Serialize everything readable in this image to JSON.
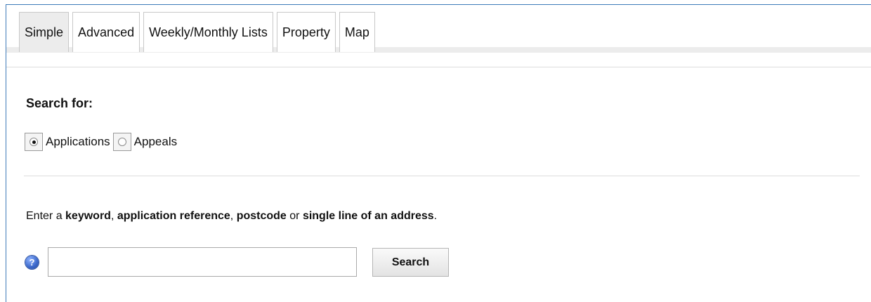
{
  "tabs": [
    {
      "label": "Simple",
      "active": true
    },
    {
      "label": "Advanced",
      "active": false
    },
    {
      "label": "Weekly/Monthly Lists",
      "active": false
    },
    {
      "label": "Property",
      "active": false
    },
    {
      "label": "Map",
      "active": false
    }
  ],
  "search_for": {
    "heading": "Search for:",
    "options": [
      {
        "label": "Applications",
        "checked": true
      },
      {
        "label": "Appeals",
        "checked": false
      }
    ]
  },
  "instructions": {
    "prefix": "Enter a ",
    "keyword": "keyword",
    "sep1": ", ",
    "application_reference": "application reference",
    "sep2": ", ",
    "postcode": "postcode",
    "sep3": " or ",
    "single_line": "single line of an address",
    "suffix": "."
  },
  "search": {
    "input_value": "",
    "button_label": "Search",
    "help_glyph": "?"
  },
  "colors": {
    "frame_border": "#3d7ab8",
    "tab_active_bg": "#ececec",
    "help_icon": "#3a67c9"
  },
  "icons": {
    "help": "help-icon"
  }
}
